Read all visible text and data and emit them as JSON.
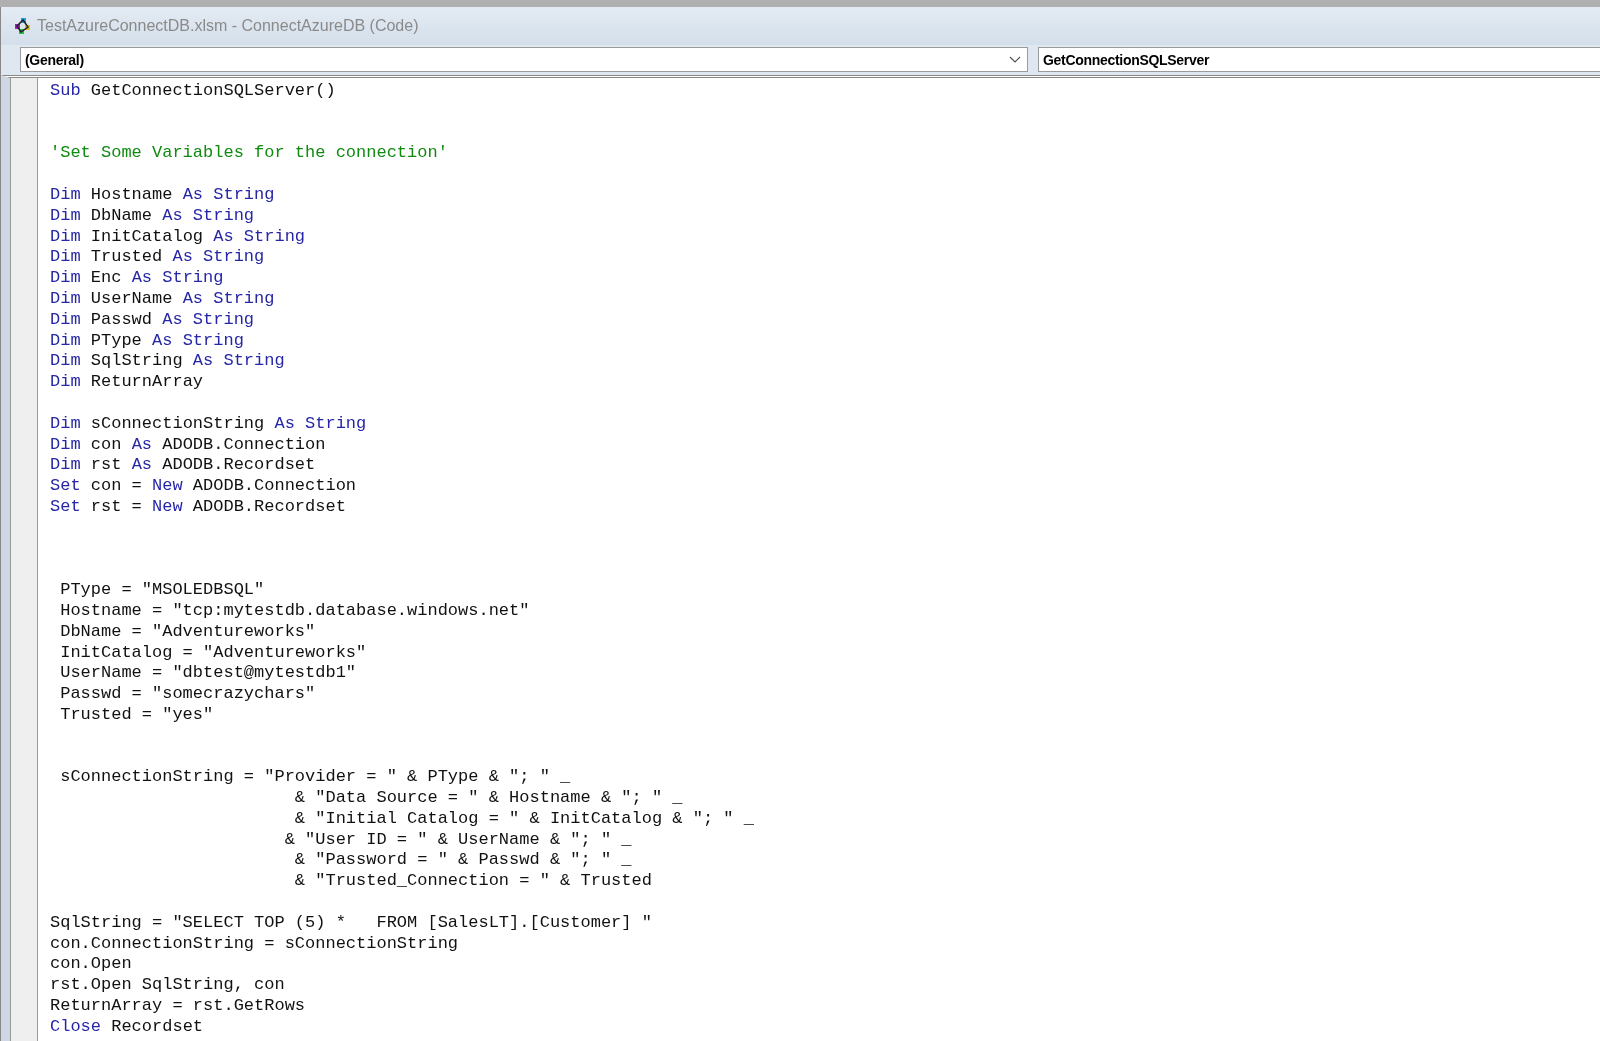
{
  "window": {
    "title": "TestAzureConnectDB.xlsm - ConnectAzureDB (Code)"
  },
  "object_box": {
    "value": "(General)"
  },
  "procedure_box": {
    "value": "GetConnectionSQLServer"
  },
  "code_lines": [
    {
      "kind": "code",
      "parts": [
        {
          "kind": "keyword",
          "text": "Sub"
        },
        {
          "kind": "plain",
          "text": " GetConnectionSQLServer()"
        }
      ]
    },
    {
      "kind": "blank"
    },
    {
      "kind": "blank"
    },
    {
      "kind": "code",
      "parts": [
        {
          "kind": "comment",
          "text": "'Set Some Variables for the connection'"
        }
      ]
    },
    {
      "kind": "blank"
    },
    {
      "kind": "code",
      "parts": [
        {
          "kind": "keyword",
          "text": "Dim"
        },
        {
          "kind": "plain",
          "text": " Hostname "
        },
        {
          "kind": "keyword",
          "text": "As String"
        }
      ]
    },
    {
      "kind": "code",
      "parts": [
        {
          "kind": "keyword",
          "text": "Dim"
        },
        {
          "kind": "plain",
          "text": " DbName "
        },
        {
          "kind": "keyword",
          "text": "As String"
        }
      ]
    },
    {
      "kind": "code",
      "parts": [
        {
          "kind": "keyword",
          "text": "Dim"
        },
        {
          "kind": "plain",
          "text": " InitCatalog "
        },
        {
          "kind": "keyword",
          "text": "As String"
        }
      ]
    },
    {
      "kind": "code",
      "parts": [
        {
          "kind": "keyword",
          "text": "Dim"
        },
        {
          "kind": "plain",
          "text": " Trusted "
        },
        {
          "kind": "keyword",
          "text": "As String"
        }
      ]
    },
    {
      "kind": "code",
      "parts": [
        {
          "kind": "keyword",
          "text": "Dim"
        },
        {
          "kind": "plain",
          "text": " Enc "
        },
        {
          "kind": "keyword",
          "text": "As String"
        }
      ]
    },
    {
      "kind": "code",
      "parts": [
        {
          "kind": "keyword",
          "text": "Dim"
        },
        {
          "kind": "plain",
          "text": " UserName "
        },
        {
          "kind": "keyword",
          "text": "As String"
        }
      ]
    },
    {
      "kind": "code",
      "parts": [
        {
          "kind": "keyword",
          "text": "Dim"
        },
        {
          "kind": "plain",
          "text": " Passwd "
        },
        {
          "kind": "keyword",
          "text": "As String"
        }
      ]
    },
    {
      "kind": "code",
      "parts": [
        {
          "kind": "keyword",
          "text": "Dim"
        },
        {
          "kind": "plain",
          "text": " PType "
        },
        {
          "kind": "keyword",
          "text": "As String"
        }
      ]
    },
    {
      "kind": "code",
      "parts": [
        {
          "kind": "keyword",
          "text": "Dim"
        },
        {
          "kind": "plain",
          "text": " SqlString "
        },
        {
          "kind": "keyword",
          "text": "As String"
        }
      ]
    },
    {
      "kind": "code",
      "parts": [
        {
          "kind": "keyword",
          "text": "Dim"
        },
        {
          "kind": "plain",
          "text": " ReturnArray"
        }
      ]
    },
    {
      "kind": "blank"
    },
    {
      "kind": "code",
      "parts": [
        {
          "kind": "keyword",
          "text": "Dim"
        },
        {
          "kind": "plain",
          "text": " sConnectionString "
        },
        {
          "kind": "keyword",
          "text": "As String"
        }
      ]
    },
    {
      "kind": "code",
      "parts": [
        {
          "kind": "keyword",
          "text": "Dim"
        },
        {
          "kind": "plain",
          "text": " con "
        },
        {
          "kind": "keyword",
          "text": "As"
        },
        {
          "kind": "plain",
          "text": " ADODB.Connection"
        }
      ]
    },
    {
      "kind": "code",
      "parts": [
        {
          "kind": "keyword",
          "text": "Dim"
        },
        {
          "kind": "plain",
          "text": " rst "
        },
        {
          "kind": "keyword",
          "text": "As"
        },
        {
          "kind": "plain",
          "text": " ADODB.Recordset"
        }
      ]
    },
    {
      "kind": "code",
      "parts": [
        {
          "kind": "keyword",
          "text": "Set"
        },
        {
          "kind": "plain",
          "text": " con = "
        },
        {
          "kind": "keyword",
          "text": "New"
        },
        {
          "kind": "plain",
          "text": " ADODB.Connection"
        }
      ]
    },
    {
      "kind": "code",
      "parts": [
        {
          "kind": "keyword",
          "text": "Set"
        },
        {
          "kind": "plain",
          "text": " rst = "
        },
        {
          "kind": "keyword",
          "text": "New"
        },
        {
          "kind": "plain",
          "text": " ADODB.Recordset"
        }
      ]
    },
    {
      "kind": "blank"
    },
    {
      "kind": "blank"
    },
    {
      "kind": "blank"
    },
    {
      "kind": "code",
      "parts": [
        {
          "kind": "plain",
          "text": " PType = \"MSOLEDBSQL\""
        }
      ]
    },
    {
      "kind": "code",
      "parts": [
        {
          "kind": "plain",
          "text": " Hostname = \"tcp:mytestdb.database.windows.net\""
        }
      ]
    },
    {
      "kind": "code",
      "parts": [
        {
          "kind": "plain",
          "text": " DbName = \"Adventureworks\""
        }
      ]
    },
    {
      "kind": "code",
      "parts": [
        {
          "kind": "plain",
          "text": " InitCatalog = \"Adventureworks\""
        }
      ]
    },
    {
      "kind": "code",
      "parts": [
        {
          "kind": "plain",
          "text": " UserName = \"dbtest@mytestdb1\""
        }
      ]
    },
    {
      "kind": "code",
      "parts": [
        {
          "kind": "plain",
          "text": " Passwd = \"somecrazychars\""
        }
      ]
    },
    {
      "kind": "code",
      "parts": [
        {
          "kind": "plain",
          "text": " Trusted = \"yes\""
        }
      ]
    },
    {
      "kind": "blank"
    },
    {
      "kind": "blank"
    },
    {
      "kind": "code",
      "parts": [
        {
          "kind": "plain",
          "text": " sConnectionString = \"Provider = \" & PType & \"; \" _"
        }
      ]
    },
    {
      "kind": "code",
      "parts": [
        {
          "kind": "plain",
          "text": "                        & \"Data Source = \" & Hostname & \"; \" _"
        }
      ]
    },
    {
      "kind": "code",
      "parts": [
        {
          "kind": "plain",
          "text": "                        & \"Initial Catalog = \" & InitCatalog & \"; \" _"
        }
      ]
    },
    {
      "kind": "code",
      "parts": [
        {
          "kind": "plain",
          "text": "                       & \"User ID = \" & UserName & \"; \" _"
        }
      ]
    },
    {
      "kind": "code",
      "parts": [
        {
          "kind": "plain",
          "text": "                        & \"Password = \" & Passwd & \"; \" _"
        }
      ]
    },
    {
      "kind": "code",
      "parts": [
        {
          "kind": "plain",
          "text": "                        & \"Trusted_Connection = \" & Trusted"
        }
      ]
    },
    {
      "kind": "blank"
    },
    {
      "kind": "code",
      "parts": [
        {
          "kind": "plain",
          "text": "SqlString = \"SELECT TOP (5) *   FROM [SalesLT].[Customer] \""
        }
      ]
    },
    {
      "kind": "code",
      "parts": [
        {
          "kind": "plain",
          "text": "con.ConnectionString = sConnectionString"
        }
      ]
    },
    {
      "kind": "code",
      "parts": [
        {
          "kind": "plain",
          "text": "con.Open"
        }
      ]
    },
    {
      "kind": "code",
      "parts": [
        {
          "kind": "plain",
          "text": "rst.Open SqlString, con"
        }
      ]
    },
    {
      "kind": "code",
      "parts": [
        {
          "kind": "plain",
          "text": "ReturnArray = rst.GetRows"
        }
      ]
    },
    {
      "kind": "code",
      "parts": [
        {
          "kind": "keyword",
          "text": "Close"
        },
        {
          "kind": "plain",
          "text": " Recordset"
        }
      ]
    }
  ]
}
